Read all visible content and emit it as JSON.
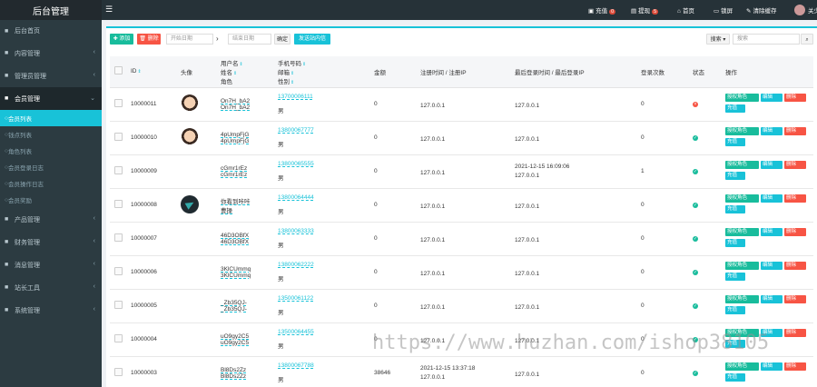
{
  "app": {
    "title": "后台管理"
  },
  "sidebar": {
    "items": [
      {
        "label": "后台首页",
        "icon": "dashboard-icon"
      },
      {
        "label": "内容管理",
        "icon": "file-icon"
      },
      {
        "label": "管理员管理",
        "icon": "users-icon"
      },
      {
        "label": "会员管理",
        "icon": "user-group-icon"
      }
    ],
    "member_sub": [
      {
        "label": "会员列表"
      },
      {
        "label": "钱点列表"
      },
      {
        "label": "角色列表"
      },
      {
        "label": "会员登录日志"
      },
      {
        "label": "会员操作日志"
      },
      {
        "label": "会员奖励"
      }
    ],
    "bottom_items": [
      {
        "label": "产品管理",
        "icon": "box-icon"
      },
      {
        "label": "财务管理",
        "icon": "money-icon"
      },
      {
        "label": "消息管理",
        "icon": "message-icon"
      },
      {
        "label": "站长工具",
        "icon": "tool-icon"
      },
      {
        "label": "系统管理",
        "icon": "gear-icon"
      }
    ]
  },
  "topbar": {
    "recharge": {
      "label": "充值",
      "count": "0"
    },
    "withdraw": {
      "label": "提现",
      "count": "5"
    },
    "home": "首页",
    "fullscreen": "锁屏",
    "clear_cache": "清除缓存",
    "user": "关少"
  },
  "toolbar": {
    "add": "添加",
    "delete": "删除",
    "start_date_placeholder": "开始日期",
    "arrow": "›",
    "end_date_placeholder": "结束日期",
    "confirm": "确定",
    "invite": "发送站内信",
    "search_select": "搜索",
    "search_placeholder": "搜索"
  },
  "table": {
    "headers": {
      "id": "ID",
      "avatar": "头像",
      "user_line1": "用户名",
      "user_line2": "姓名",
      "user_line3": "角色",
      "contact_line1": "手机号码",
      "contact_line2": "邮箱",
      "contact_line3": "性别",
      "balance": "金额",
      "register": "注册时间 / 注册IP",
      "last_login": "最后登录时间 / 最后登录IP",
      "login_count": "登录次数",
      "status": "状态",
      "actions": "操作"
    },
    "action_labels": {
      "role": "授权角色",
      "edit": "编辑",
      "delete": "删除",
      "recharge": "充值"
    },
    "rows": [
      {
        "id": "10000011",
        "avatar": "face",
        "username": "On7H_bA2",
        "name": "On7H_bA2",
        "phone": "13700006111",
        "gender": "男",
        "balance": "0",
        "reg_time": "",
        "reg_ip": "127.0.0.1",
        "last_time": "",
        "last_ip": "127.0.0.1",
        "login_count": "0",
        "status": "no"
      },
      {
        "id": "10000010",
        "avatar": "face",
        "username": "4pUmpFjG",
        "name": "4pUmpFjG",
        "phone": "13800067777",
        "gender": "男",
        "balance": "0",
        "reg_time": "",
        "reg_ip": "127.0.0.1",
        "last_time": "",
        "last_ip": "127.0.0.1",
        "login_count": "0",
        "status": "ok"
      },
      {
        "id": "10000009",
        "avatar": "",
        "username": "cGmr1rEz",
        "name": "cGmr1rEz",
        "phone": "13800065555",
        "gender": "男",
        "balance": "0",
        "reg_time": "",
        "reg_ip": "127.0.0.1",
        "last_time": "2021-12-15 16:09:06",
        "last_ip": "127.0.0.1",
        "login_count": "1",
        "status": "ok"
      },
      {
        "id": "10000008",
        "avatar": "dark",
        "username": "你看到咔咔",
        "name": "曹操",
        "phone": "13800064444",
        "gender": "男",
        "balance": "0",
        "reg_time": "",
        "reg_ip": "127.0.0.1",
        "last_time": "",
        "last_ip": "127.0.0.1",
        "login_count": "0",
        "status": "ok"
      },
      {
        "id": "10000007",
        "avatar": "",
        "username": "46D3OBfX",
        "name": "46D3OBfX",
        "phone": "13800063333",
        "gender": "男",
        "balance": "0",
        "reg_time": "",
        "reg_ip": "127.0.0.1",
        "last_time": "",
        "last_ip": "127.0.0.1",
        "login_count": "0",
        "status": "ok"
      },
      {
        "id": "10000006",
        "avatar": "",
        "username": "3KlCUmmq",
        "name": "3KlCUmmq",
        "phone": "13800062222",
        "gender": "男",
        "balance": "0",
        "reg_time": "",
        "reg_ip": "127.0.0.1",
        "last_time": "",
        "last_ip": "127.0.0.1",
        "login_count": "0",
        "status": "ok"
      },
      {
        "id": "10000005",
        "avatar": "",
        "username": "_Zb35QJ-",
        "name": "_Zb35QJ-",
        "phone": "13500061122",
        "gender": "男",
        "balance": "0",
        "reg_time": "",
        "reg_ip": "127.0.0.1",
        "last_time": "",
        "last_ip": "127.0.0.1",
        "login_count": "0",
        "status": "ok"
      },
      {
        "id": "10000004",
        "avatar": "",
        "username": "uO9gy2C5",
        "name": "uO9gy2C5",
        "phone": "13500064455",
        "gender": "男",
        "balance": "0",
        "reg_time": "",
        "reg_ip": "127.0.0.1",
        "last_time": "",
        "last_ip": "127.0.0.1",
        "login_count": "0",
        "status": "ok"
      },
      {
        "id": "10000003",
        "avatar": "",
        "username": "Bl8Ds2Zz",
        "name": "Bl8Ds2Zz",
        "phone": "13800067788",
        "gender": "男",
        "balance": "38646",
        "reg_time": "2021-12-15 13:37:18",
        "reg_ip": "127.0.0.1",
        "last_time": "",
        "last_ip": "127.0.0.1",
        "login_count": "0",
        "status": "ok"
      }
    ]
  },
  "watermark": "https://www.huzhan.com/ishop38105"
}
